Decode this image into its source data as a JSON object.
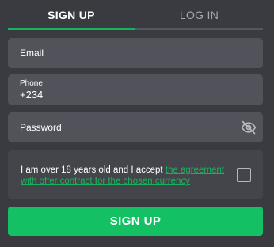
{
  "tabs": {
    "signup_label": "SIGN UP",
    "login_label": "LOG IN",
    "active": "signup"
  },
  "form": {
    "email_placeholder": "Email",
    "phone_label": "Phone",
    "phone_value": "+234",
    "password_placeholder": "Password",
    "password_toggle_icon": "eye-slash-icon"
  },
  "agreement": {
    "text_prefix": "I am over 18 years old and I accept ",
    "link_text": "the agreement with offer contract for the chosen currency",
    "checked": false
  },
  "submit_label": "SIGN UP",
  "colors": {
    "background": "#3a3b41",
    "input_bg": "#51525a",
    "accent_green": "#13c064",
    "link_green": "#17b35c",
    "inactive_tab_text": "#a6a7ac"
  }
}
